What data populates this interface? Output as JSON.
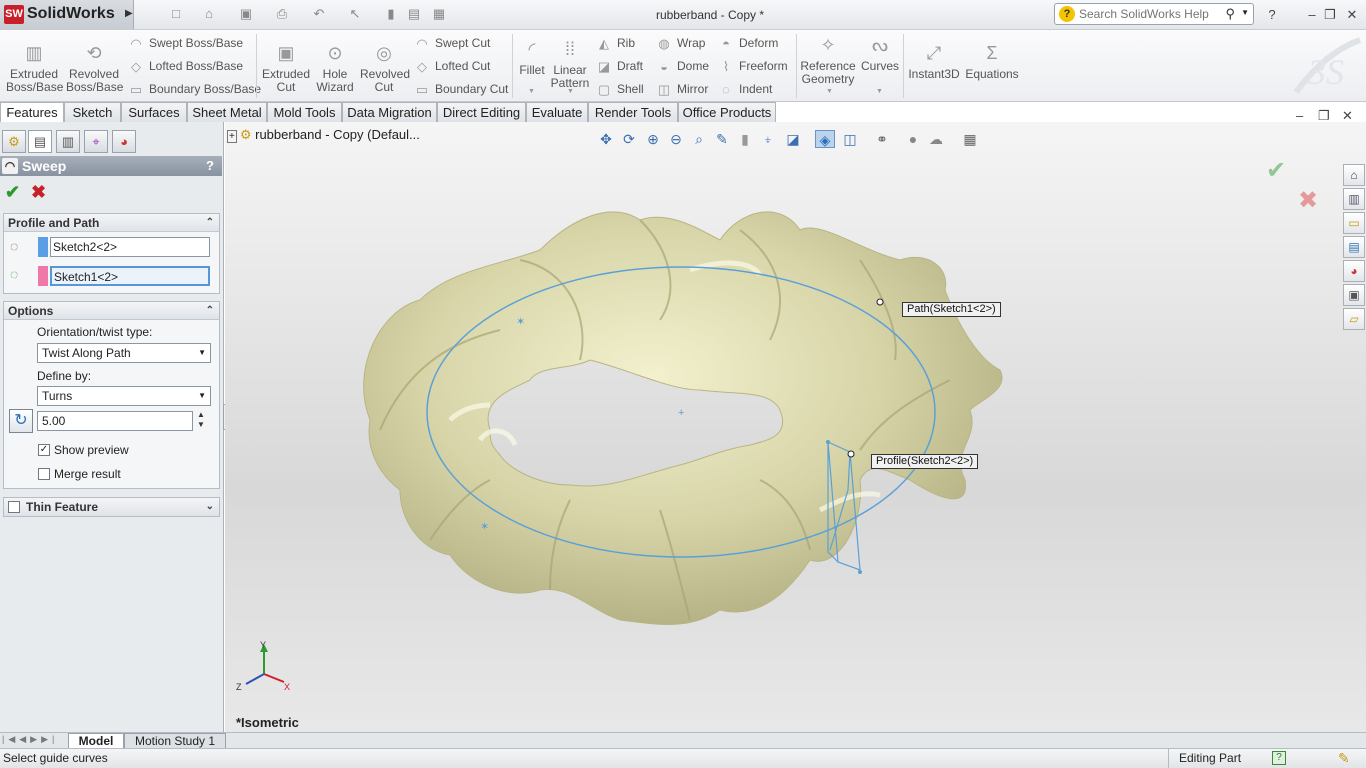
{
  "app": {
    "name": "SolidWorks",
    "doc_title": "rubberband - Copy *"
  },
  "search": {
    "placeholder": "Search SolidWorks Help"
  },
  "toolbar": {
    "extruded_boss": "Extruded Boss/Base",
    "revolved_boss": "Revolved Boss/Base",
    "swept_boss": "Swept Boss/Base",
    "lofted_boss": "Lofted Boss/Base",
    "boundary_boss": "Boundary Boss/Base",
    "extruded_cut": "Extruded Cut",
    "hole_wizard": "Hole Wizard",
    "revolved_cut": "Revolved Cut",
    "swept_cut": "Swept Cut",
    "lofted_cut": "Lofted Cut",
    "boundary_cut": "Boundary Cut",
    "fillet": "Fillet",
    "linear_pattern": "Linear Pattern",
    "rib": "Rib",
    "draft": "Draft",
    "shell": "Shell",
    "wrap": "Wrap",
    "dome": "Dome",
    "mirror": "Mirror",
    "deform": "Deform",
    "freeform": "Freeform",
    "indent": "Indent",
    "reference_geometry": "Reference Geometry",
    "curves": "Curves",
    "instant3d": "Instant3D",
    "equations": "Equations"
  },
  "tabs": [
    "Features",
    "Sketch",
    "Surfaces",
    "Sheet Metal",
    "Mold Tools",
    "Data Migration",
    "Direct Editing",
    "Evaluate",
    "Render Tools",
    "Office Products"
  ],
  "property_manager": {
    "title": "Sweep",
    "help": "?",
    "profile_path": {
      "heading": "Profile and Path",
      "profile": "Sketch2<2>",
      "path": "Sketch1<2>"
    },
    "options": {
      "heading": "Options",
      "orientation_label": "Orientation/twist type:",
      "orientation_value": "Twist Along Path",
      "define_by_label": "Define by:",
      "define_by_value": "Turns",
      "turns_value": "5.00",
      "show_preview": "Show preview",
      "merge_result": "Merge result"
    },
    "thin_feature": "Thin Feature"
  },
  "viewport": {
    "tree_root": "rubberband - Copy  (Defaul...",
    "view_label": "*Isometric",
    "callout_path": "Path(Sketch1<2>)",
    "callout_profile": "Profile(Sketch2<2>)",
    "axes": {
      "x": "X",
      "y": "Y",
      "z": "Z"
    }
  },
  "bottom_tabs": [
    "Model",
    "Motion Study 1"
  ],
  "status": {
    "left": "Select guide curves",
    "mode": "Editing Part",
    "help": "?"
  },
  "colors": {
    "accent": "#5a95d8",
    "path_line": "#5aa0d8",
    "model_fill": "#c9c89a"
  }
}
